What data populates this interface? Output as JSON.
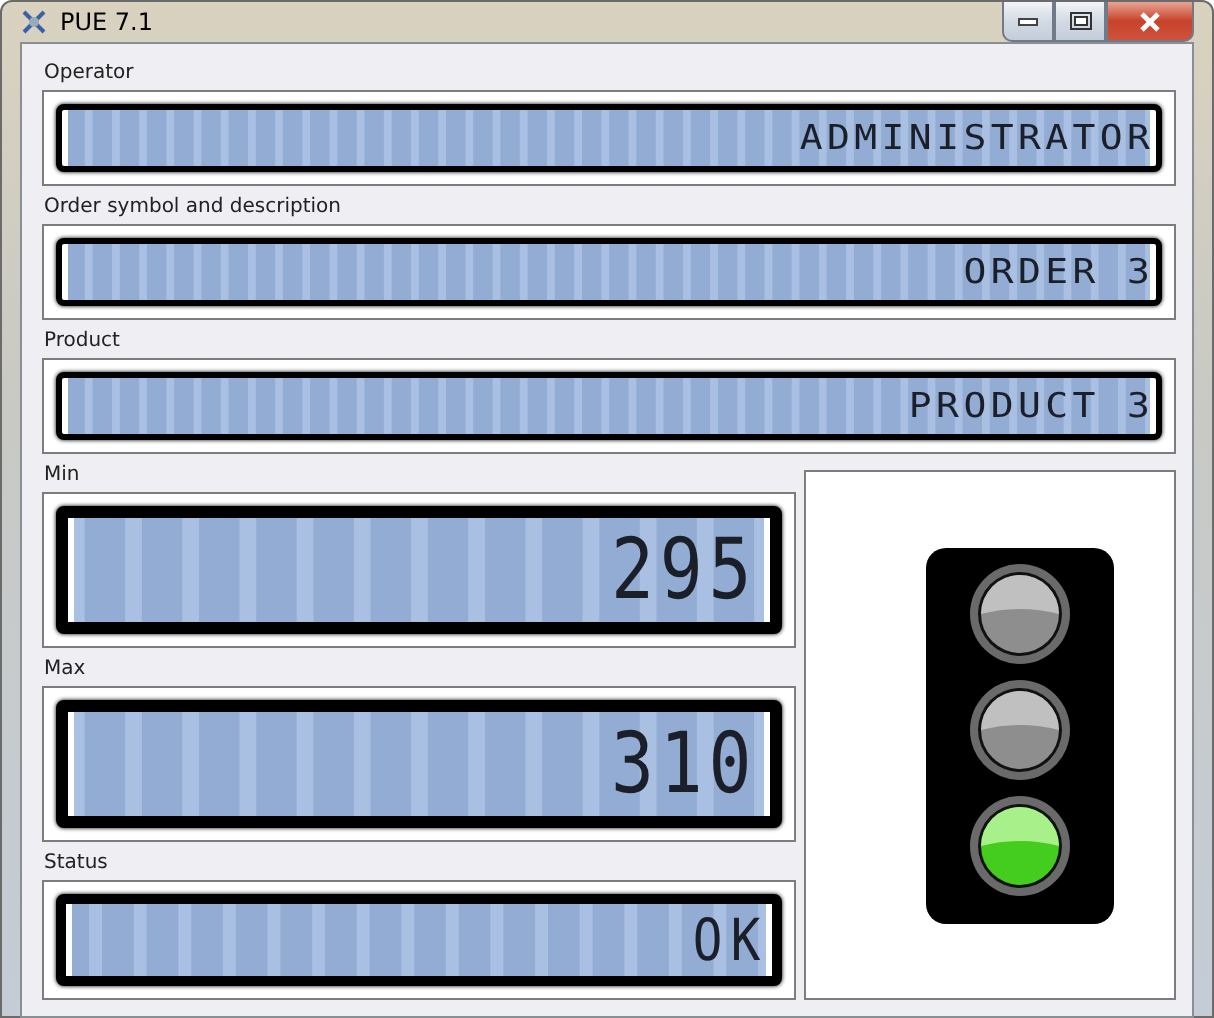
{
  "window": {
    "title": "PUE 7.1"
  },
  "info_fields": [
    {
      "label": "Operator",
      "value": "ADMINISTRATOR"
    },
    {
      "label": "Order symbol and description",
      "value": "ORDER 3"
    },
    {
      "label": "Product",
      "value": "PRODUCT 3"
    }
  ],
  "limit_fields": [
    {
      "label": "Min",
      "value": "295"
    },
    {
      "label": "Max",
      "value": "310"
    }
  ],
  "status": {
    "label": "Status",
    "value": "OK"
  },
  "traffic_light": {
    "lights": [
      {
        "on": false
      },
      {
        "on": false
      },
      {
        "on": true
      }
    ]
  }
}
